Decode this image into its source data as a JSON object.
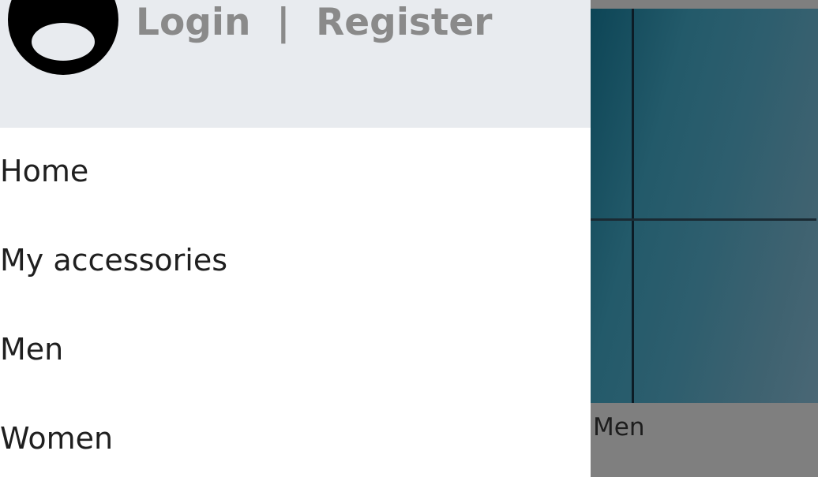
{
  "drawer": {
    "header": {
      "login_label": "Login",
      "separator": "|",
      "register_label": "Register",
      "avatar_icon": "user-circle-icon"
    },
    "nav_items": [
      {
        "label": "Home"
      },
      {
        "label": "My accessories"
      },
      {
        "label": "Men"
      },
      {
        "label": "Women"
      }
    ]
  },
  "background_page": {
    "hero_caption": "Men"
  },
  "colors": {
    "drawer_header_bg": "#e8ebef",
    "auth_text": "#8a8a8a",
    "nav_text": "#1f1f1f",
    "overlay_bg": "#7f7f7f"
  }
}
